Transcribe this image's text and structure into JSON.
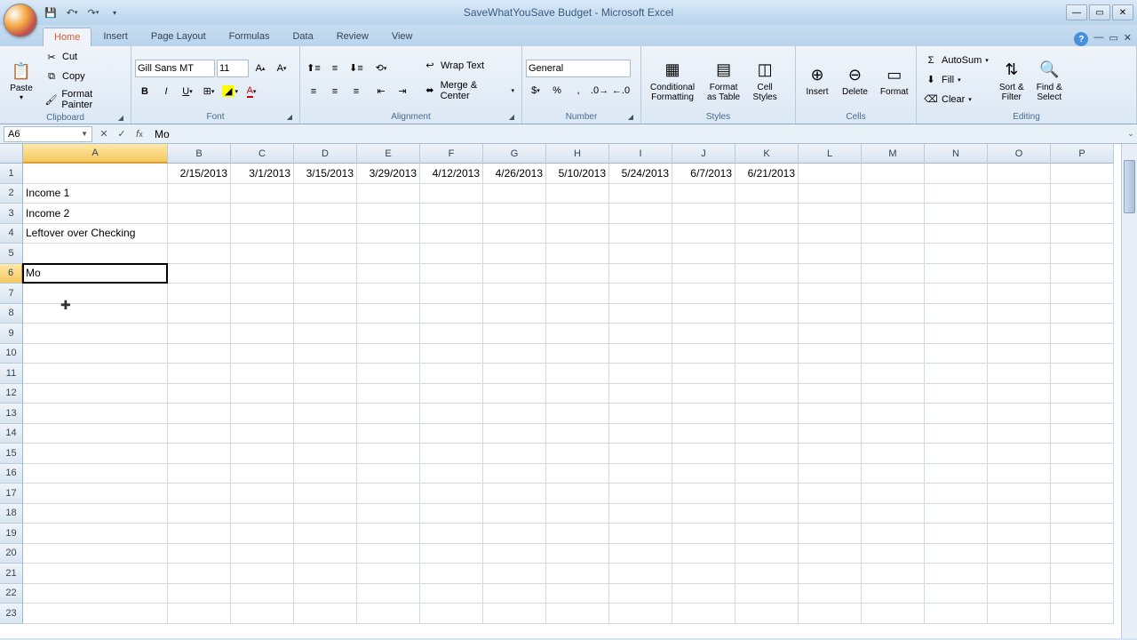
{
  "title": "SaveWhatYouSave Budget - Microsoft Excel",
  "tabs": [
    "Home",
    "Insert",
    "Page Layout",
    "Formulas",
    "Data",
    "Review",
    "View"
  ],
  "clipboard": {
    "cut": "Cut",
    "copy": "Copy",
    "format_painter": "Format Painter",
    "paste": "Paste",
    "label": "Clipboard"
  },
  "font": {
    "name": "Gill Sans MT",
    "size": "11",
    "label": "Font"
  },
  "alignment": {
    "wrap": "Wrap Text",
    "merge": "Merge & Center",
    "label": "Alignment"
  },
  "number": {
    "format": "General",
    "label": "Number"
  },
  "styles": {
    "conditional": "Conditional\nFormatting",
    "format_table": "Format\nas Table",
    "cell_styles": "Cell\nStyles",
    "label": "Styles"
  },
  "cells_group": {
    "insert": "Insert",
    "delete": "Delete",
    "format": "Format",
    "label": "Cells"
  },
  "editing": {
    "autosum": "AutoSum",
    "fill": "Fill",
    "clear": "Clear",
    "sort": "Sort &\nFilter",
    "find": "Find &\nSelect",
    "label": "Editing"
  },
  "namebox": "A6",
  "formula": "Mo",
  "columns": [
    {
      "l": "A",
      "w": 163
    },
    {
      "l": "B",
      "w": 71
    },
    {
      "l": "C",
      "w": 71
    },
    {
      "l": "D",
      "w": 71
    },
    {
      "l": "E",
      "w": 71
    },
    {
      "l": "F",
      "w": 71
    },
    {
      "l": "G",
      "w": 71
    },
    {
      "l": "H",
      "w": 71
    },
    {
      "l": "I",
      "w": 71
    },
    {
      "l": "J",
      "w": 71
    },
    {
      "l": "K",
      "w": 71
    },
    {
      "l": "L",
      "w": 71
    },
    {
      "l": "M",
      "w": 71
    },
    {
      "l": "N",
      "w": 71
    },
    {
      "l": "O",
      "w": 71
    },
    {
      "l": "P",
      "w": 71
    }
  ],
  "row_heights": 22.5,
  "row_count": 23,
  "selected_col": 0,
  "selected_row": 5,
  "chart_data": {
    "type": "table",
    "headers_row": 1,
    "dates": [
      "2/15/2013",
      "3/1/2013",
      "3/15/2013",
      "3/29/2013",
      "4/12/2013",
      "4/26/2013",
      "5/10/2013",
      "5/24/2013",
      "6/7/2013",
      "6/21/2013"
    ],
    "rows": [
      {
        "label": "Income 1"
      },
      {
        "label": "Income 2"
      },
      {
        "label": "Leftover over Checking"
      }
    ],
    "editing_cell": {
      "ref": "A6",
      "value": "Mo"
    }
  }
}
